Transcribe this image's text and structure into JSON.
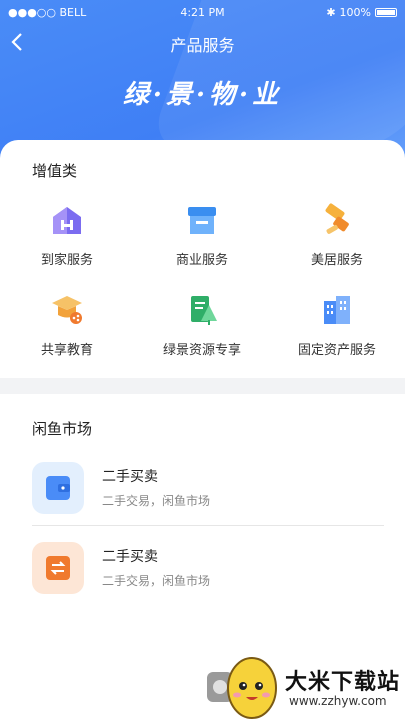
{
  "status_bar": {
    "carrier": "●●●○○ BELL",
    "time": "4:21 PM",
    "battery": "100%"
  },
  "nav": {
    "title": "产品服务",
    "back": "<"
  },
  "banner": {
    "slogan": "绿·景·物·业"
  },
  "value_added": {
    "title": "增值类",
    "items": [
      {
        "label": "到家服务",
        "icon": "house-icon"
      },
      {
        "label": "商业服务",
        "icon": "shop-icon"
      },
      {
        "label": "美居服务",
        "icon": "paint-roller-icon"
      },
      {
        "label": "共享教育",
        "icon": "graduation-cap-icon"
      },
      {
        "label": "绿景资源专享",
        "icon": "document-tree-icon"
      },
      {
        "label": "固定资产服务",
        "icon": "building-icon"
      }
    ]
  },
  "market": {
    "title": "闲鱼市场",
    "items": [
      {
        "title": "二手买卖",
        "subtitle": "二手交易，闲鱼市场",
        "icon": "wallet-icon"
      },
      {
        "title": "二手买卖",
        "subtitle": "二手交易，闲鱼市场",
        "icon": "exchange-icon"
      }
    ]
  },
  "watermark": {
    "name": "大米下载站",
    "url": "www.zzhyw.com"
  },
  "colors": {
    "primary": "#3f7ff5",
    "orange": "#f07a2e",
    "green": "#32b36b"
  }
}
